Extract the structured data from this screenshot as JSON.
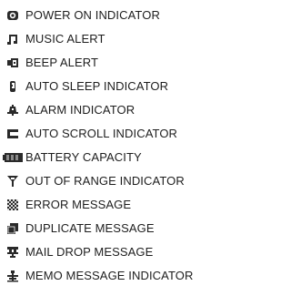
{
  "legend": {
    "items": [
      {
        "icon": "power-on-icon",
        "label": "POWER ON INDICATOR"
      },
      {
        "icon": "music-note-icon",
        "label": "MUSIC ALERT"
      },
      {
        "icon": "beep-speaker-icon",
        "label": "BEEP ALERT"
      },
      {
        "icon": "auto-sleep-icon",
        "label": "AUTO SLEEP INDICATOR"
      },
      {
        "icon": "alarm-bell-icon",
        "label": "ALARM INDICATOR"
      },
      {
        "icon": "auto-scroll-icon",
        "label": "AUTO SCROLL INDICATOR"
      },
      {
        "icon": "battery-icon",
        "label": "BATTERY CAPACITY"
      },
      {
        "icon": "antenna-icon",
        "label": "OUT OF RANGE INDICATOR"
      },
      {
        "icon": "error-checker-icon",
        "label": "ERROR MESSAGE"
      },
      {
        "icon": "duplicate-message-icon",
        "label": "DUPLICATE MESSAGE"
      },
      {
        "icon": "mail-drop-icon",
        "label": "MAIL DROP MESSAGE"
      },
      {
        "icon": "memo-message-icon",
        "label": "MEMO MESSAGE INDICATOR"
      }
    ]
  },
  "colors": {
    "icon": "#2a2a2a",
    "text": "#1e1e1e",
    "background": "#ffffff"
  }
}
